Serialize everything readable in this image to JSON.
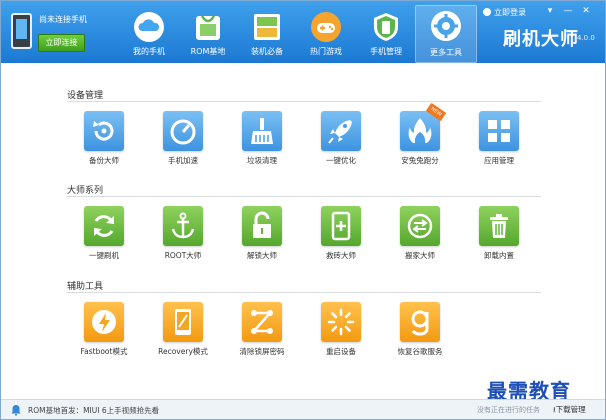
{
  "header": {
    "device_status": "尚未连接手机",
    "connect_button": "立即连接",
    "nav": [
      {
        "label": "我的手机",
        "icon": "cloud-icon"
      },
      {
        "label": "ROM基地",
        "icon": "shopping-bag-icon"
      },
      {
        "label": "装机必备",
        "icon": "app-grid-icon"
      },
      {
        "label": "热门游戏",
        "icon": "gamepad-icon"
      },
      {
        "label": "手机管理",
        "icon": "shield-icon"
      },
      {
        "label": "更多工具",
        "icon": "gear-icon"
      }
    ],
    "login": "立即登录",
    "brand": "刷机大师",
    "version": "4.0.0"
  },
  "sections": [
    {
      "title": "设备管理",
      "tools": [
        {
          "label": "备份大师",
          "icon": "backup-restore-icon",
          "color": "#4fa6ea"
        },
        {
          "label": "手机加速",
          "icon": "speedometer-icon",
          "color": "#4fa6ea"
        },
        {
          "label": "垃圾清理",
          "icon": "broom-icon",
          "color": "#4fa6ea"
        },
        {
          "label": "一键优化",
          "icon": "rocket-icon",
          "color": "#4fa6ea"
        },
        {
          "label": "安兔兔跑分",
          "icon": "antutu-flame-icon",
          "color": "#4fa6ea",
          "badge": "NEW"
        },
        {
          "label": "应用管理",
          "icon": "app-tiles-icon",
          "color": "#4fa6ea"
        }
      ]
    },
    {
      "title": "大师系列",
      "tools": [
        {
          "label": "一键刷机",
          "icon": "refresh-icon",
          "color": "#6cbd3e"
        },
        {
          "label": "ROOT大师",
          "icon": "anchor-icon",
          "color": "#6cbd3e"
        },
        {
          "label": "解锁大师",
          "icon": "unlock-icon",
          "color": "#6cbd3e"
        },
        {
          "label": "救砖大师",
          "icon": "phone-plus-icon",
          "color": "#6cbd3e"
        },
        {
          "label": "搬家大师",
          "icon": "transfer-arrows-icon",
          "color": "#6cbd3e"
        },
        {
          "label": "卸载内置",
          "icon": "trash-icon",
          "color": "#6cbd3e"
        }
      ]
    },
    {
      "title": "辅助工具",
      "tools": [
        {
          "label": "Fastboot模式",
          "icon": "lightning-icon",
          "color": "#f6ab2a"
        },
        {
          "label": "Recovery模式",
          "icon": "tablet-recovery-icon",
          "color": "#f6ab2a"
        },
        {
          "label": "清除锁屏密码",
          "icon": "pattern-lock-icon",
          "color": "#f6ab2a"
        },
        {
          "label": "重启设备",
          "icon": "spinner-restart-icon",
          "color": "#f6ab2a"
        },
        {
          "label": "恢复谷歌服务",
          "icon": "google-g-icon",
          "color": "#f6ab2a"
        }
      ]
    }
  ],
  "statusbar": {
    "message": "ROM基地首发：MIUI 6上手视频抢先看",
    "task_info": "没有正在进行的任务",
    "download_manager": "下载管理"
  },
  "watermark": "最需教育"
}
